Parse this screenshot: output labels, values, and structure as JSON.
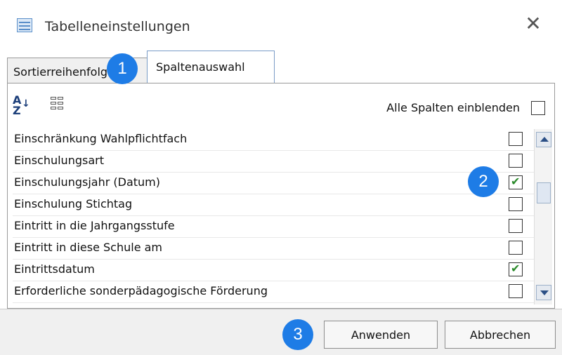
{
  "window": {
    "title": "Tabelleneinstellungen",
    "close_symbol": "✕",
    "icon": "table-icon"
  },
  "tabs": [
    {
      "label": "Sortierreihenfolge",
      "active": false
    },
    {
      "label": "Spaltenauswahl",
      "active": true
    }
  ],
  "toolbar": {
    "sort_az_icon": "sort-az-icon",
    "column_layout_icon": "column-layout-icon",
    "show_all_label": "Alle Spalten einblenden",
    "show_all_checked": false
  },
  "columns": [
    {
      "label": "Einschränkung Wahlpflichtfach",
      "checked": false
    },
    {
      "label": "Einschulungsart",
      "checked": false
    },
    {
      "label": "Einschulungsjahr (Datum)",
      "checked": true
    },
    {
      "label": "Einschulung Stichtag",
      "checked": false
    },
    {
      "label": "Eintritt in die Jahrgangsstufe",
      "checked": false
    },
    {
      "label": "Eintritt in diese Schule am",
      "checked": false
    },
    {
      "label": "Eintrittsdatum",
      "checked": true
    },
    {
      "label": "Erforderliche sonderpädagogische Förderung",
      "checked": false
    }
  ],
  "buttons": {
    "apply": "Anwenden",
    "cancel": "Abbrechen"
  },
  "callouts": [
    "1",
    "2",
    "3"
  ],
  "colors": {
    "callout": "#1e7ce6",
    "check": "#2a8a2a",
    "footer_bg": "#f0f0f0"
  }
}
